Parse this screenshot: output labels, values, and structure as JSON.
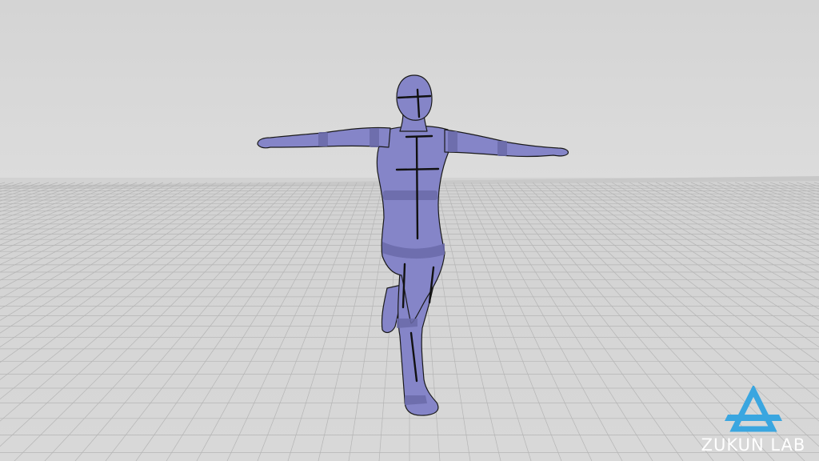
{
  "scene": {
    "description_kind": "3d-figure-render",
    "colors": {
      "sky": "#d9d9d9",
      "floor": "#cfcfcf",
      "grid": "#b3b3b3",
      "figure": "#8585c8",
      "figure_band": "#6868a8",
      "outline": "#1a1a1a"
    }
  },
  "watermark": {
    "brand": "ZUKUN LAB",
    "icon": "triangle-logo-icon",
    "color": "#3aa6e0"
  }
}
